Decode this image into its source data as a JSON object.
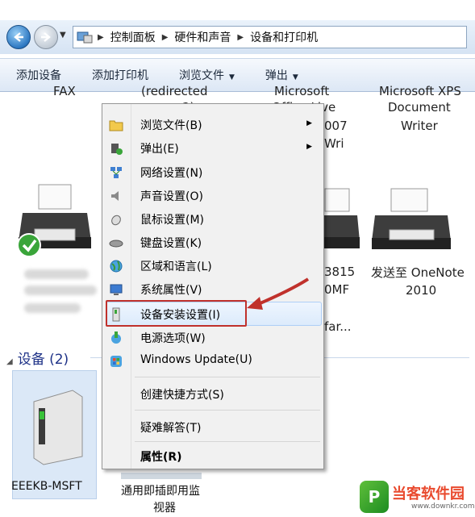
{
  "breadcrumb": [
    "控制面板",
    "硬件和声音",
    "设备和打印机"
  ],
  "toolbar": {
    "items": [
      "添加设备",
      "添加打印机",
      "浏览文件",
      "弹出"
    ]
  },
  "background_fragments": {
    "f1": "FAX",
    "f2": "(redirected",
    "f3": "2)",
    "f4": "Microsoft",
    "f5": "Office Live",
    "f6": "007",
    "f7": "Wri",
    "f8": "Microsoft XPS",
    "f9": "Document",
    "f10": "Writer",
    "f11": "3815",
    "f12": "0MF",
    "f13": "far...",
    "onenote_line1": "发送至 OneNote",
    "onenote_line2": "2010"
  },
  "devices_section": {
    "label": "设备 (2)"
  },
  "device1": {
    "label": "EEEKB-MSFT"
  },
  "device2": {
    "line1": "通用即插即用监",
    "line2": "视器"
  },
  "context_menu": {
    "items": [
      {
        "label": "浏览文件(B)",
        "icon": "folder-icon",
        "submenu": true
      },
      {
        "label": "弹出(E)",
        "icon": "eject-icon",
        "submenu": true
      },
      {
        "label": "网络设置(N)",
        "icon": "network-icon"
      },
      {
        "label": "声音设置(O)",
        "icon": "speaker-icon"
      },
      {
        "label": "鼠标设置(M)",
        "icon": "mouse-icon"
      },
      {
        "label": "键盘设置(K)",
        "icon": "keyboard-icon"
      },
      {
        "label": "区域和语言(L)",
        "icon": "globe-icon"
      },
      {
        "label": "系统属性(V)",
        "icon": "system-icon"
      },
      {
        "label": "设备安装设置(I)",
        "icon": "device-install-icon",
        "highlighted": true
      },
      {
        "label": "电源选项(W)",
        "icon": "power-icon"
      },
      {
        "label": "Windows Update(U)",
        "icon": "windows-update-icon"
      },
      {
        "label": "创建快捷方式(S)"
      },
      {
        "label": "疑难解答(T)"
      },
      {
        "label": "属性(R)",
        "bold": true
      }
    ]
  },
  "watermark": {
    "text": "当客软件园",
    "url": "www.downkr.com"
  },
  "colors": {
    "highlight_border": "#c0312c",
    "accent": "#1e3287"
  }
}
